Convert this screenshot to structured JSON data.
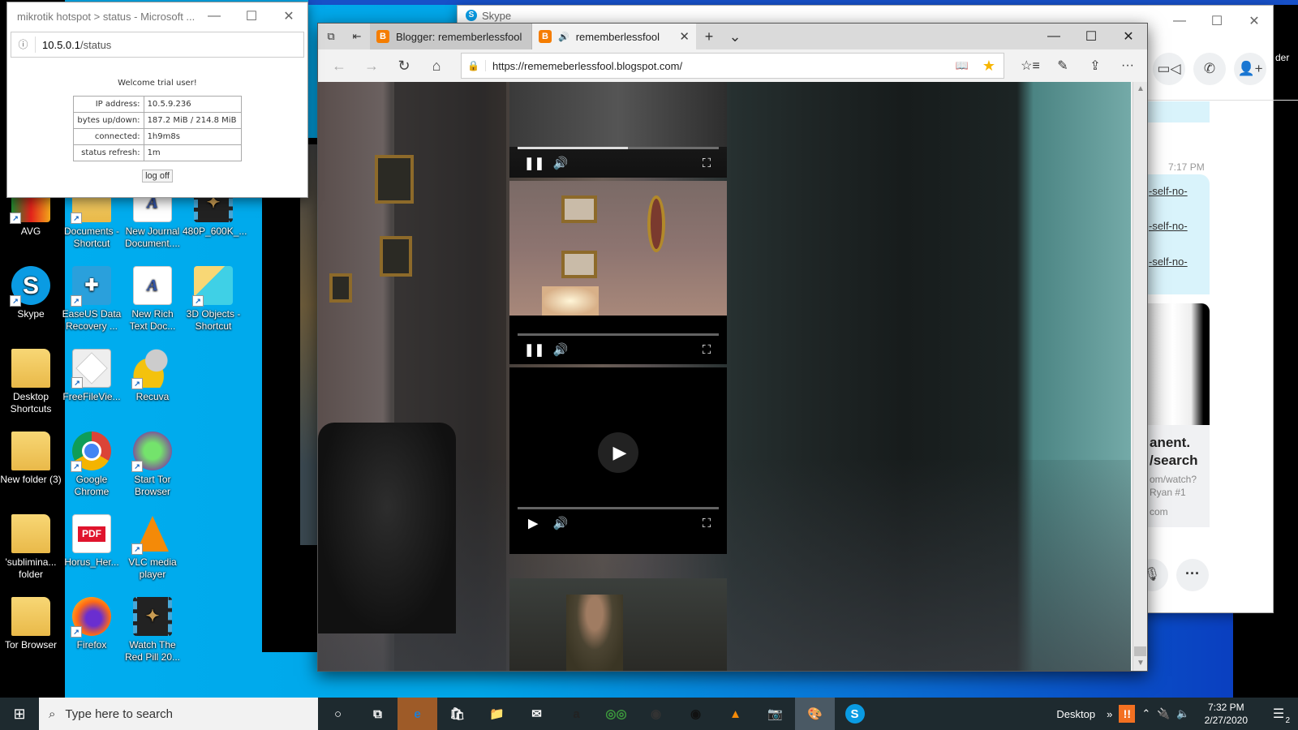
{
  "desktop": {
    "icons": [
      {
        "label": "AVG",
        "type": "avg",
        "shortcut": true
      },
      {
        "label": "Documents - Shortcut",
        "type": "folder",
        "shortcut": true
      },
      {
        "label": "New Journal Document....",
        "type": "doc",
        "shortcut": false
      },
      {
        "label": "480P_600K_...",
        "type": "film",
        "shortcut": false
      },
      {
        "label": "Skype",
        "type": "skype",
        "shortcut": true
      },
      {
        "label": "EaseUS Data Recovery ...",
        "type": "easeus",
        "shortcut": true
      },
      {
        "label": "New Rich Text Doc...",
        "type": "doc",
        "shortcut": false
      },
      {
        "label": "3D Objects - Shortcut",
        "type": "objs",
        "shortcut": true
      },
      {
        "label": "Desktop Shortcuts",
        "type": "folder",
        "shortcut": false
      },
      {
        "label": "FreeFileVie...",
        "type": "ffv",
        "shortcut": true
      },
      {
        "label": "Recuva",
        "type": "recuva",
        "shortcut": true
      },
      {
        "label": "New folder (3)",
        "type": "folder",
        "shortcut": false
      },
      {
        "label": "Google Chrome",
        "type": "chrome",
        "shortcut": true
      },
      {
        "label": "Start Tor Browser",
        "type": "tor",
        "shortcut": true
      },
      {
        "label": "'sublimina... folder",
        "type": "folder",
        "shortcut": false
      },
      {
        "label": "Horus_Her...",
        "type": "pdf",
        "shortcut": false
      },
      {
        "label": "VLC media player",
        "type": "vlc",
        "shortcut": true
      },
      {
        "label": "Tor Browser",
        "type": "folder",
        "shortcut": false
      },
      {
        "label": "Firefox",
        "type": "firefox",
        "shortcut": true
      },
      {
        "label": "Watch The Red Pill 20...",
        "type": "film",
        "shortcut": false
      }
    ]
  },
  "hotspot_window": {
    "title": "mikrotik hotspot > status - Microsoft ...",
    "address_host": "10.5.0.1",
    "address_path": "/status",
    "welcome": "Welcome trial user!",
    "rows": [
      {
        "key": "IP address:",
        "value": "10.5.9.236"
      },
      {
        "key": "bytes up/down:",
        "value": "187.2 MiB / 214.8 MiB"
      },
      {
        "key": "connected:",
        "value": "1h9m8s"
      },
      {
        "key": "status refresh:",
        "value": "1m"
      }
    ],
    "logoff_label": "log off",
    "minimize": "—",
    "maximize": "☐",
    "close": "✕"
  },
  "skype_window": {
    "title": "Skype",
    "logo": "S",
    "time": "7:17 PM",
    "links": [
      "-self-no-",
      "-self-no-",
      "-self-no-"
    ],
    "card_title_1": "anent.",
    "card_title_2": "/search",
    "card_line_1": "om/watch?",
    "card_line_2": "Ryan #1",
    "card_domain": "com",
    "edge_text": "der",
    "minimize": "—",
    "maximize": "☐",
    "close": "✕",
    "video_call": "▭◁",
    "audio_call": "✆",
    "add_people": "👤+",
    "mic": "🎙",
    "more": "···"
  },
  "edge_window": {
    "tabs": [
      {
        "title": "Blogger: rememberlessfool",
        "icon": "B",
        "active": false
      },
      {
        "title": "rememberlessfool",
        "icon": "B",
        "active": true,
        "audio": "🔊"
      }
    ],
    "new_tab": "+",
    "tab_list": "⌄",
    "minimize": "—",
    "maximize": "☐",
    "close": "✕",
    "url": "https://rememeberlessfool.blogspot.com/",
    "nav": {
      "back": "←",
      "forward": "→",
      "refresh": "↻",
      "home": "⌂"
    },
    "tools": {
      "favorites": "☆≡",
      "notes": "✎",
      "share": "⇪",
      "more": "···"
    },
    "videos": [
      {
        "state": "playing",
        "progress": 0.55,
        "thumbnail": "adult-content-thumbnail"
      },
      {
        "state": "playing",
        "progress": 0.0,
        "thumbnail": "room-with-frames"
      },
      {
        "state": "paused",
        "progress": 0.0,
        "thumbnail": "black"
      }
    ]
  },
  "taskbar": {
    "start": "⊞",
    "search_placeholder": "Type here to search",
    "apps": [
      {
        "name": "cortana",
        "symbol": "○"
      },
      {
        "name": "task-view",
        "symbol": "⧉"
      },
      {
        "name": "edge",
        "symbol": "e"
      },
      {
        "name": "store",
        "symbol": "🛍"
      },
      {
        "name": "file-explorer",
        "symbol": "📁"
      },
      {
        "name": "mail",
        "symbol": "✉"
      },
      {
        "name": "amazon",
        "symbol": "a"
      },
      {
        "name": "tripadvisor",
        "symbol": "◎◎"
      },
      {
        "name": "camera-app",
        "symbol": "◉"
      },
      {
        "name": "color-app",
        "symbol": "◉"
      },
      {
        "name": "vlc",
        "symbol": "▲"
      },
      {
        "name": "camera",
        "symbol": "📷"
      },
      {
        "name": "paint",
        "symbol": "🎨"
      },
      {
        "name": "skype",
        "symbol": "S"
      }
    ],
    "desktop_label": "Desktop",
    "tray_overflow": "»",
    "alert_symbol": "!!",
    "time": "7:32 PM",
    "date": "2/27/2020",
    "notifications_count": "2"
  }
}
